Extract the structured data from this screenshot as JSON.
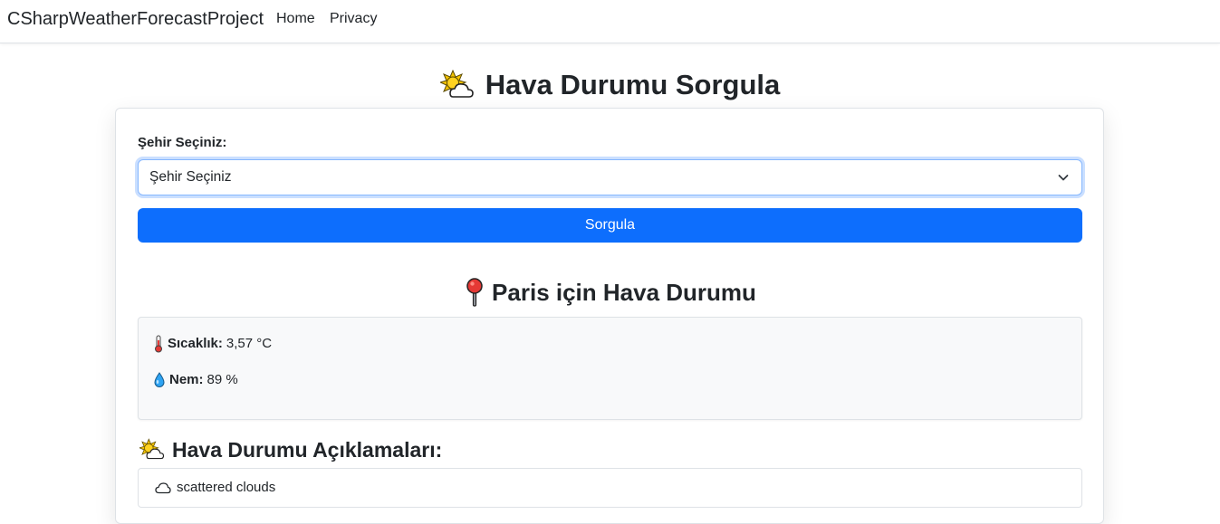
{
  "navbar": {
    "brand": "CSharpWeatherForecastProject",
    "links": [
      "Home",
      "Privacy"
    ]
  },
  "page": {
    "title": "Hava Durumu Sorgula",
    "title_icon": "sun-behind-cloud-icon"
  },
  "form": {
    "city_label": "Şehir Seçiniz:",
    "city_select_value": "Şehir Seçiniz",
    "submit_label": "Sorgula"
  },
  "result": {
    "city_title": "Paris için Hava Durumu",
    "city_title_icon": "pushpin-icon",
    "temperature_label": "Sıcaklık:",
    "temperature_value": "3,57 °C",
    "humidity_label": "Nem:",
    "humidity_value": "89 %",
    "descriptions_title": "Hava Durumu Açıklamaları:",
    "descriptions": [
      "scattered clouds"
    ]
  },
  "colors": {
    "primary": "#0d6efd",
    "focus_border": "#86b7fe",
    "info_background": "#f8f9fa"
  }
}
